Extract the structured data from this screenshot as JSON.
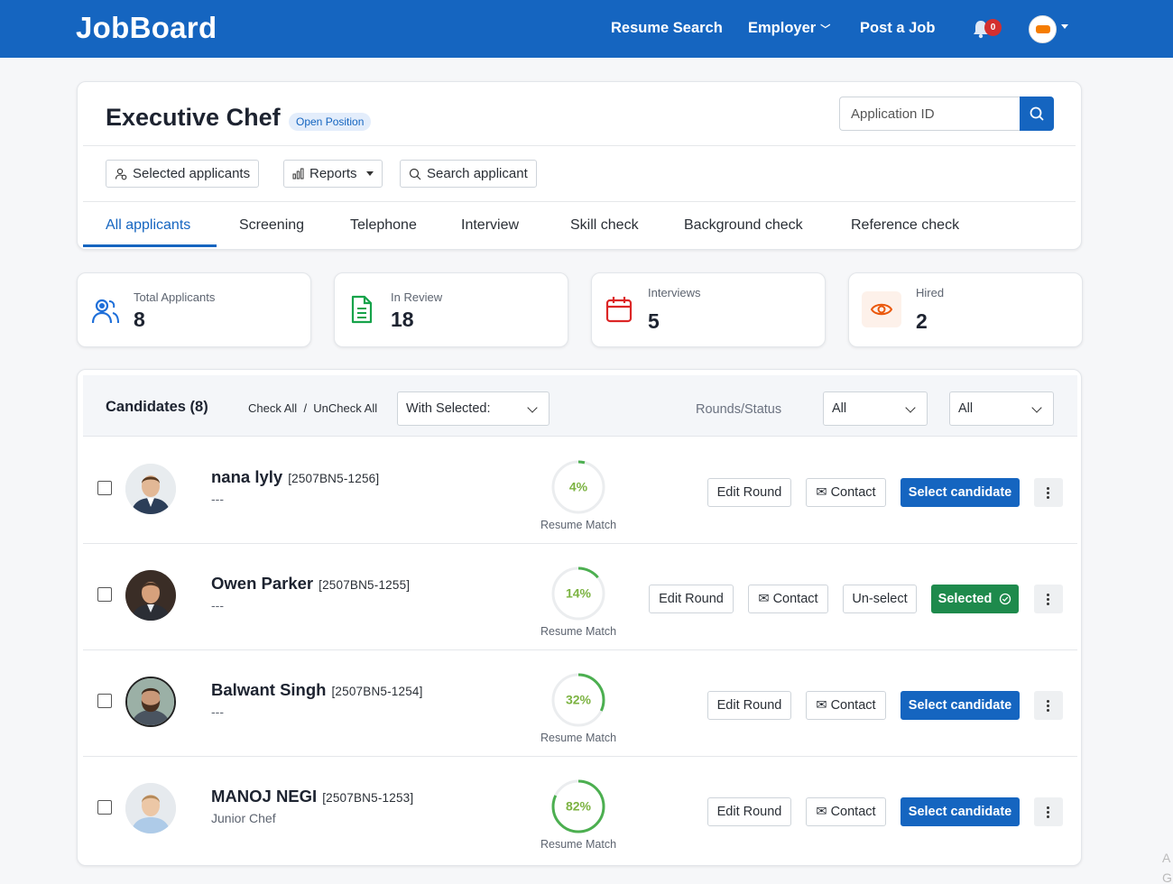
{
  "nav": {
    "brand": "JobBoard",
    "links": [
      "Resume Search",
      "Employer",
      "Post a Job"
    ],
    "notification_count": "0"
  },
  "job": {
    "title": "Executive Chef",
    "status": "Open Position",
    "search_placeholder": "Application ID",
    "toolbar": [
      "Selected applicants",
      "Reports",
      "Search applicant"
    ],
    "tabs": [
      "All applicants",
      "Screening",
      "Telephone",
      "Interview",
      "Skill check",
      "Background check",
      "Reference check"
    ],
    "active_tab": "All applicants"
  },
  "stats": [
    {
      "label": "Total Applicants",
      "value": "8",
      "icon": "users-icon",
      "color": "#1e6fd9"
    },
    {
      "label": "In Review",
      "value": "18",
      "icon": "document-icon",
      "color": "#16a34a"
    },
    {
      "label": "Interviews",
      "value": "5",
      "icon": "calendar-icon",
      "color": "#dc2626"
    },
    {
      "label": "Hired",
      "value": "2",
      "icon": "eye-icon",
      "color": "#ea580c"
    }
  ],
  "candidates": {
    "title": "Candidates (8)",
    "check_all": "Check All",
    "uncheck_all": "UnCheck All",
    "with_selected": "With Selected:",
    "rounds_label": "Rounds/Status",
    "filter_1": "All",
    "filter_2": "All",
    "match_label": "Resume Match",
    "rows": [
      {
        "name": "nana lyly",
        "code": "[2507BN5-1256]",
        "subtitle": "---",
        "match": 4,
        "match_text": "4%",
        "selected": false
      },
      {
        "name": "Owen Parker",
        "code": "[2507BN5-1255]",
        "subtitle": "---",
        "match": 14,
        "match_text": "14%",
        "selected": true
      },
      {
        "name": "Balwant Singh",
        "code": "[2507BN5-1254]",
        "subtitle": "---",
        "match": 32,
        "match_text": "32%",
        "selected": false
      },
      {
        "name": "MANOJ NEGI",
        "code": "[2507BN5-1253]",
        "subtitle": "Junior Chef",
        "match": 82,
        "match_text": "82%",
        "selected": false
      }
    ],
    "buttons": {
      "edit_round": "Edit Round",
      "contact": "Contact",
      "select": "Select candidate",
      "unselect": "Un-select",
      "selected": "Selected"
    }
  },
  "colors": {
    "primary": "#1565c0",
    "success": "#1e8a4c",
    "ring": "#4caf50"
  },
  "corner_text": "A\nG"
}
